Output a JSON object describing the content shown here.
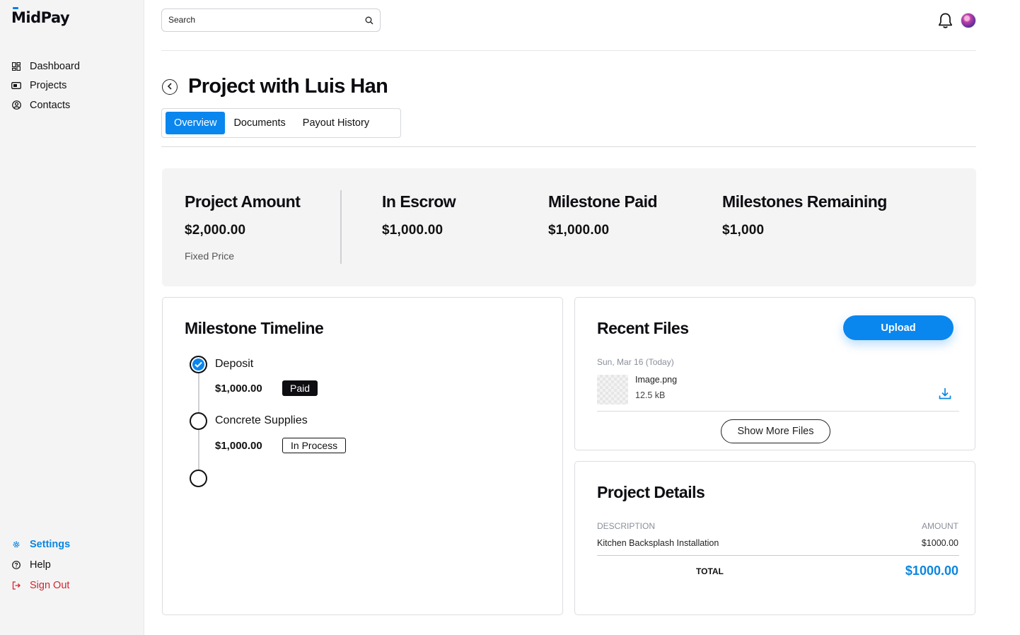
{
  "app": {
    "logo": "MidPay"
  },
  "sidebar": {
    "nav": [
      {
        "label": "Dashboard",
        "icon": "dashboard-icon"
      },
      {
        "label": "Projects",
        "icon": "projects-icon"
      },
      {
        "label": "Contacts",
        "icon": "contacts-icon"
      }
    ],
    "bottom": [
      {
        "label": "Settings",
        "icon": "gear-icon",
        "active": true
      },
      {
        "label": "Help",
        "icon": "help-icon"
      },
      {
        "label": "Sign Out",
        "icon": "sign-out-icon"
      }
    ]
  },
  "topbar": {
    "search_placeholder": "Search"
  },
  "page": {
    "title": "Project with Luis Han",
    "tabs": [
      "Overview",
      "Documents",
      "Payout History"
    ],
    "active_tab": "Overview"
  },
  "summary": {
    "project_amount": {
      "label": "Project Amount",
      "value": "$2,000.00",
      "sub": "Fixed Price"
    },
    "in_escrow": {
      "label": "In Escrow",
      "value": "$1,000.00"
    },
    "milestone_paid": {
      "label": "Milestone Paid",
      "value": "$1,000.00"
    },
    "milestones_remaining": {
      "label": "Milestones Remaining",
      "value": "$1,000"
    }
  },
  "timeline": {
    "title": "Milestone Timeline",
    "items": [
      {
        "name": "Deposit",
        "amount": "$1,000.00",
        "status": "Paid"
      },
      {
        "name": "Concrete Supplies",
        "amount": "$1,000.00",
        "status": "In Process"
      }
    ]
  },
  "files": {
    "title": "Recent Files",
    "upload_label": "Upload",
    "date": "Sun, Mar 16 (Today)",
    "items": [
      {
        "name": "Image.png",
        "size": "12.5 kB"
      }
    ],
    "show_more_label": "Show More Files"
  },
  "details": {
    "title": "Project Details",
    "col_description": "DESCRIPTION",
    "col_amount": "AMOUNT",
    "rows": [
      {
        "description": "Kitchen Backsplash Installation",
        "amount": "$1000.00"
      }
    ],
    "total_label": "TOTAL",
    "total_value": "$1000.00"
  },
  "colors": {
    "accent": "#0a86ef",
    "danger": "#d4252c",
    "sidebar_bg": "#f4f4f5"
  }
}
